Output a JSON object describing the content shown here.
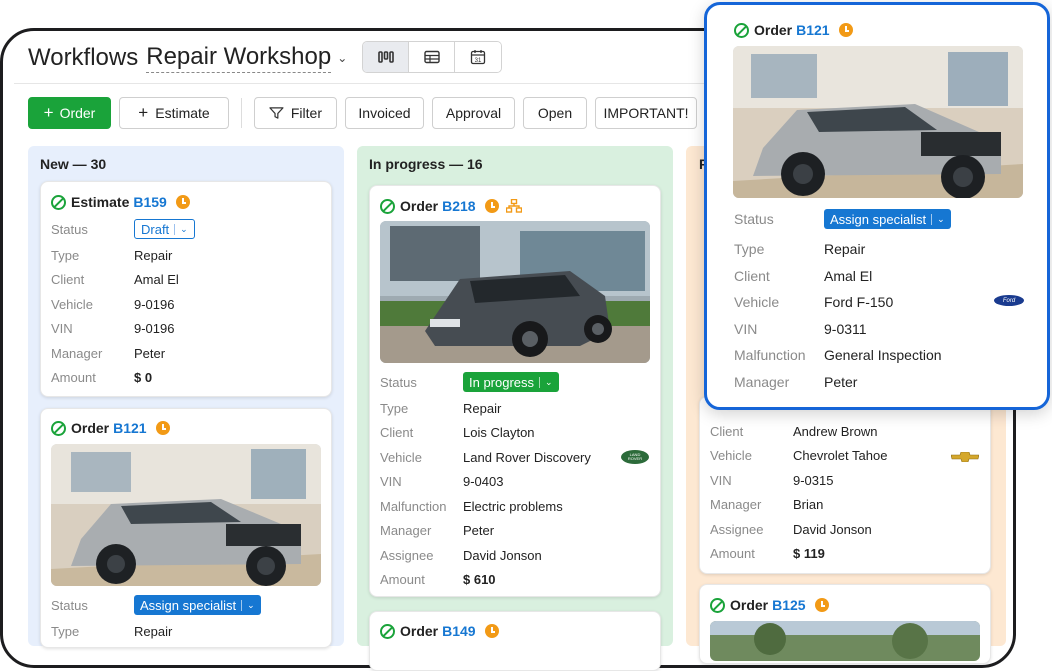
{
  "header": {
    "title": "Workflows",
    "workflow": "Repair Workshop"
  },
  "view_icons": [
    "kanban-icon",
    "table-icon",
    "calendar-icon"
  ],
  "calendar_day": "31",
  "toolbar": {
    "order": "Order",
    "estimate": "Estimate",
    "filter": "Filter",
    "chips": [
      "Invoiced",
      "Approval",
      "Open",
      "IMPORTANT!"
    ]
  },
  "columns": [
    {
      "title": "New — 30"
    },
    {
      "title": "In progress — 16"
    },
    {
      "title": "R"
    }
  ],
  "cards": {
    "c1": {
      "kind": "Estimate",
      "num": "B159",
      "status": "Draft",
      "rows": [
        {
          "k": "Type",
          "v": "Repair"
        },
        {
          "k": "Client",
          "v": "Amal El"
        },
        {
          "k": "Vehicle",
          "v": "9-0196"
        },
        {
          "k": "VIN",
          "v": "9-0196"
        },
        {
          "k": "Manager",
          "v": "Peter"
        },
        {
          "k": "Amount",
          "v": "$ 0"
        }
      ]
    },
    "c2": {
      "kind": "Order",
      "num": "B121",
      "status_label": "Status",
      "status": "Assign specialist",
      "rows": [
        {
          "k": "Type",
          "v": "Repair"
        }
      ]
    },
    "c3": {
      "kind": "Order",
      "num": "B218",
      "status_label": "Status",
      "status": "In progress",
      "rows": [
        {
          "k": "Type",
          "v": "Repair"
        },
        {
          "k": "Client",
          "v": "Lois Clayton"
        },
        {
          "k": "Vehicle",
          "v": "Land Rover Discovery"
        },
        {
          "k": "VIN",
          "v": "9-0403"
        },
        {
          "k": "Malfunction",
          "v": "Electric problems"
        },
        {
          "k": "Manager",
          "v": "Peter"
        },
        {
          "k": "Assignee",
          "v": "David Jonson"
        },
        {
          "k": "Amount",
          "v": "$ 610"
        }
      ],
      "logo": "LAND ROVER"
    },
    "c4": {
      "kind": "Order",
      "num": "B149"
    },
    "c5": {
      "rows": [
        {
          "k": "Client",
          "v": "Andrew Brown"
        },
        {
          "k": "Vehicle",
          "v": "Chevrolet Tahoe"
        },
        {
          "k": "VIN",
          "v": "9-0315"
        },
        {
          "k": "Manager",
          "v": "Brian"
        },
        {
          "k": "Assignee",
          "v": "David Jonson"
        },
        {
          "k": "Amount",
          "v": "$ 119"
        }
      ]
    },
    "c6": {
      "kind": "Order",
      "num": "B125"
    }
  },
  "popup": {
    "kind": "Order",
    "num": "B121",
    "status_label": "Status",
    "status": "Assign specialist",
    "rows": [
      {
        "k": "Type",
        "v": "Repair"
      },
      {
        "k": "Client",
        "v": "Amal El"
      },
      {
        "k": "Vehicle",
        "v": "Ford F-150"
      },
      {
        "k": "VIN",
        "v": "9-0311"
      },
      {
        "k": "Malfunction",
        "v": "General Inspection"
      },
      {
        "k": "Manager",
        "v": "Peter"
      }
    ],
    "logo": "Ford"
  },
  "colors": {
    "green": "#1aa33a",
    "blue": "#1677d2",
    "orange": "#f29a16",
    "popup_border": "#1565d8"
  }
}
